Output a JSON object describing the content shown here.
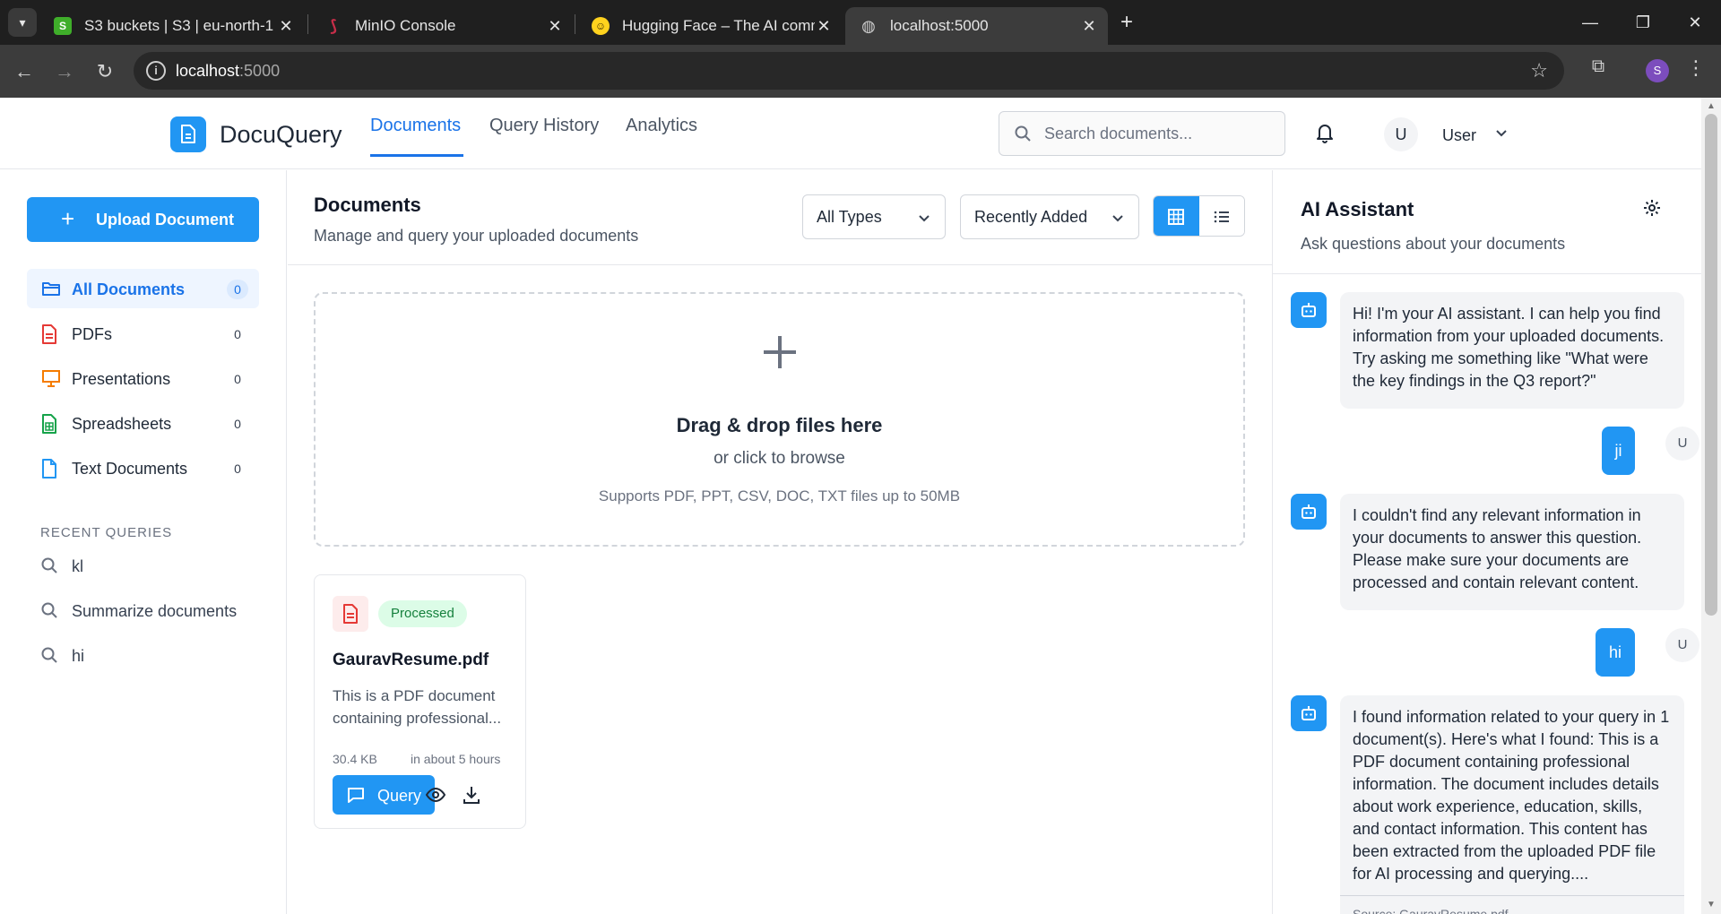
{
  "browser": {
    "tabs": [
      {
        "title": "S3 buckets | S3 | eu-north-1",
        "icon": "aws-s3-icon"
      },
      {
        "title": "MinIO Console",
        "icon": "minio-icon"
      },
      {
        "title": "Hugging Face – The AI commun",
        "icon": "hugging-face-icon"
      },
      {
        "title": "localhost:5000",
        "icon": "globe-icon"
      }
    ],
    "url_host": "localhost",
    "url_port": ":5000",
    "profile_initial": "S"
  },
  "header": {
    "brand": "DocuQuery",
    "nav": [
      "Documents",
      "Query History",
      "Analytics"
    ],
    "search_placeholder": "Search documents...",
    "avatar_initial": "U",
    "user_name": "User"
  },
  "sidebar": {
    "upload_label": "Upload Document",
    "items": [
      {
        "label": "All Documents",
        "count": "0"
      },
      {
        "label": "PDFs",
        "count": "0"
      },
      {
        "label": "Presentations",
        "count": "0"
      },
      {
        "label": "Spreadsheets",
        "count": "0"
      },
      {
        "label": "Text Documents",
        "count": "0"
      }
    ],
    "recent_heading": "RECENT QUERIES",
    "recent": [
      "kl",
      "Summarize documents",
      "hi"
    ]
  },
  "main": {
    "title": "Documents",
    "subtitle": "Manage and query your uploaded documents",
    "type_filter": "All Types",
    "sort": "Recently Added",
    "dropzone": {
      "title": "Drag & drop files here",
      "subtitle": "or click to browse",
      "note": "Supports PDF, PPT, CSV, DOC, TXT files up to 50MB"
    },
    "documents": [
      {
        "status": "Processed",
        "name": "GauravResume.pdf",
        "description": "This is a PDF document containing professional...",
        "size": "30.4 KB",
        "time": "in about 5 hours",
        "query_label": "Query"
      }
    ]
  },
  "assistant": {
    "title": "AI Assistant",
    "subtitle": "Ask questions about your documents",
    "messages": [
      {
        "role": "bot",
        "text": "Hi! I'm your AI assistant. I can help you find information from your uploaded documents. Try asking me something like \"What were the key findings in the Q3 report?\""
      },
      {
        "role": "user",
        "text": "ji",
        "initial": "U"
      },
      {
        "role": "bot",
        "text": "I couldn't find any relevant information in your documents to answer this question. Please make sure your documents are processed and contain relevant content."
      },
      {
        "role": "user",
        "text": "hi",
        "initial": "U"
      },
      {
        "role": "bot",
        "text": "I found information related to your query in 1 document(s). Here's what I found: This is a PDF document containing professional information. The document includes details about work experience, education, skills, and contact information. This content has been extracted from the uploaded PDF file for AI processing and querying...."
      }
    ],
    "sources_snippet": "Source: GauravResume.pdf"
  },
  "colors": {
    "accent": "#2196f3",
    "nav_active": "#1a73e8",
    "badge_bg": "#dcfce7",
    "badge_text": "#15803d",
    "pdf_red": "#e53935",
    "presentation_orange": "#f57c00",
    "spreadsheet_green": "#16a34a"
  }
}
